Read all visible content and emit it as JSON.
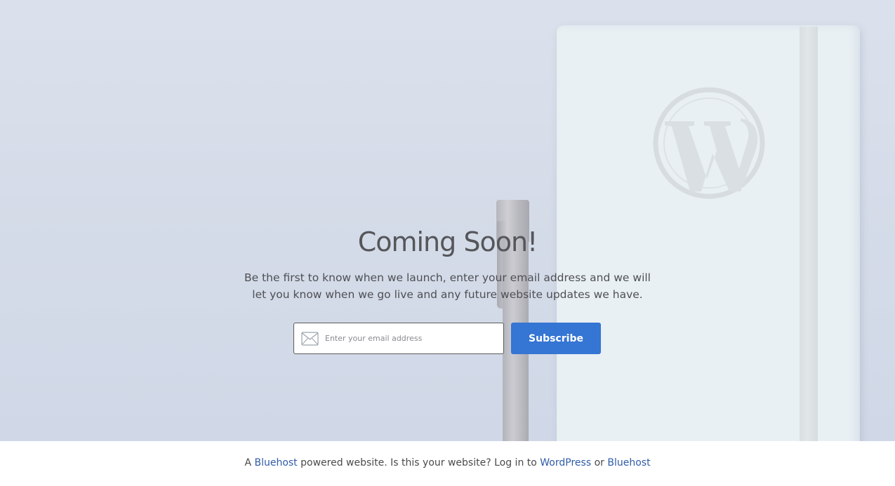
{
  "hero": {
    "title": "Coming Soon!",
    "subtitle": "Be the first to know when we launch, enter your email address and we will let you know when we go live and any future website updates we have.",
    "background_image": "notebook-and-pen-photo",
    "logo_icon": "wordpress-icon"
  },
  "form": {
    "email_placeholder": "Enter your email address",
    "email_value": "",
    "email_icon": "envelope-icon",
    "subscribe_label": "Subscribe"
  },
  "footer": {
    "text_a": "A",
    "link_bluehost_1": "Bluehost",
    "text_b": "powered website. Is this your website? Log in to",
    "link_wordpress": "WordPress",
    "text_or": "or",
    "link_bluehost_2": "Bluehost"
  },
  "colors": {
    "accent": "#3575d3",
    "link": "#2f5ba8",
    "hero_bg": "#d4dbe8",
    "title_text": "#555659"
  }
}
